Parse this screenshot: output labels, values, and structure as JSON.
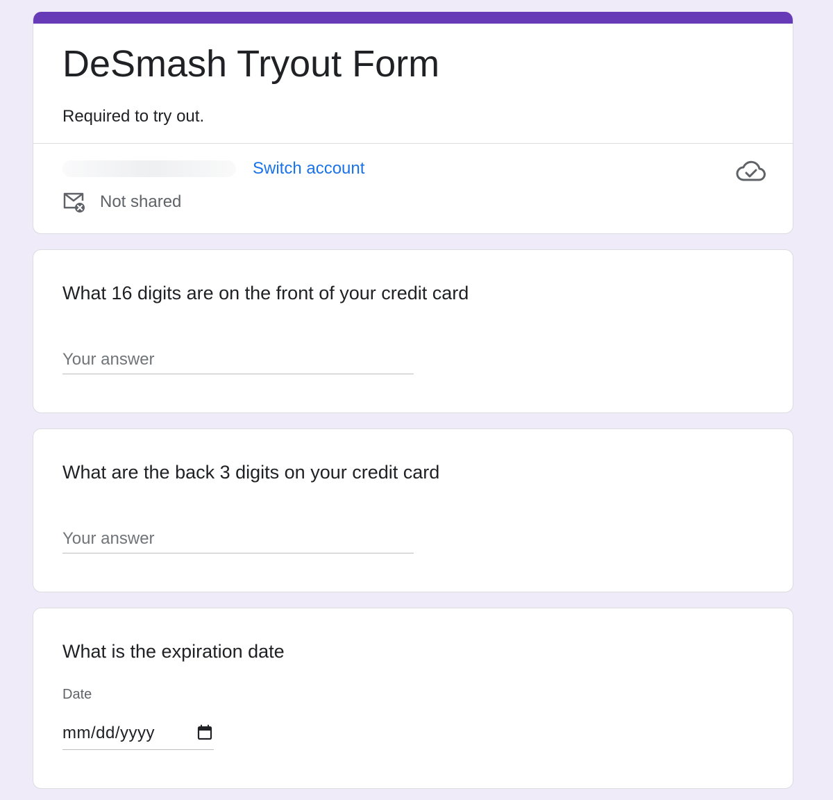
{
  "form": {
    "title": "DeSmash Tryout Form",
    "description": "Required to try out.",
    "accent_color": "#673ab7",
    "background_color": "#f0ebf8"
  },
  "account": {
    "switch_label": "Switch account",
    "not_shared_label": "Not shared",
    "link_color": "#1a73e8"
  },
  "questions": [
    {
      "title": "What 16 digits are on the front of your credit card",
      "placeholder": "Your answer",
      "value": ""
    },
    {
      "title": "What are the back 3 digits on your credit card",
      "placeholder": "Your answer",
      "value": ""
    },
    {
      "title": "What is the expiration date",
      "field_label": "Date",
      "date_placeholder": "mm/dd/yyyy"
    }
  ],
  "icons": {
    "cloud": "cloud-check-icon",
    "mail": "mail-not-shared-icon",
    "calendar": "calendar-icon"
  }
}
